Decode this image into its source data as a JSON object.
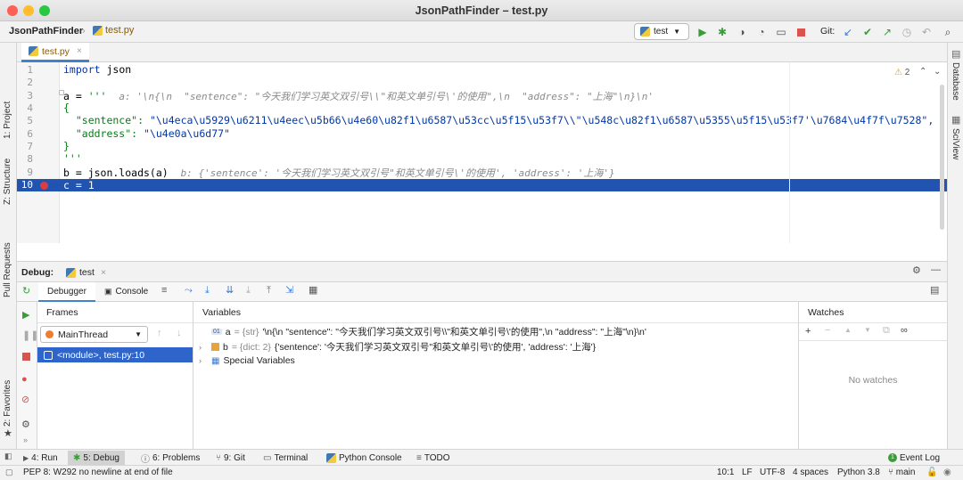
{
  "window": {
    "title": "JsonPathFinder – test.py"
  },
  "nav": {
    "project": "JsonPathFinder",
    "file": "test.py",
    "run_config": "test",
    "git_label": "Git:"
  },
  "left_stripe": {
    "project": "1: Project",
    "structure": "Z: Structure",
    "pull_requests": "Pull Requests",
    "favorites": "2: Favorites"
  },
  "right_stripe": {
    "database": "Database",
    "sciview": "SciView"
  },
  "editor": {
    "tab": "test.py",
    "warnings_count": "2",
    "line_numbers": [
      "1",
      "2",
      "3",
      "4",
      "5",
      "6",
      "7",
      "8",
      "9",
      "10"
    ],
    "line1": {
      "kw": "import",
      "rest": " json"
    },
    "line3": {
      "code": "a = ",
      "str": "'''",
      "inlay": "a: '\\n{\\n  \"sentence\": \"今天我们学习英文双引号\\\\\"和英文单引号\\'的使用\",\\n  \"address\": \"上海\"\\n}\\n'"
    },
    "line4": "{",
    "line5": {
      "key": "  \"sentence\"",
      "colon": ": ",
      "val": "\"\\u4eca\\u5929\\u6211\\u4eec\\u5b66\\u4e60\\u82f1\\u6587\\u53cc\\u5f15\\u53f7\\\\\"\\u548c\\u82f1\\u6587\\u5355\\u5f15\\u53f7'\\u7684\\u4f7f\\u7528\","
    },
    "line6": {
      "key": "  \"address\"",
      "colon": ": ",
      "val": "\"\\u4e0a\\u6d77\""
    },
    "line7": "}",
    "line8": "'''",
    "line9": {
      "code": "b = json.loads(a)",
      "inlay": "b: {'sentence': '今天我们学习英文双引号\"和英文单引号\\'的使用', 'address': '上海'}"
    },
    "line10": "c = 1"
  },
  "debug": {
    "label": "Debug:",
    "run_tab": "test",
    "tabs": {
      "debugger": "Debugger",
      "console": "Console"
    },
    "frames": {
      "title": "Frames",
      "thread": "MainThread",
      "frame": "<module>, test.py:10"
    },
    "variables": {
      "title": "Variables",
      "rows": [
        {
          "name": "a",
          "type": "= {str}",
          "value": "'\\n{\\n  \"sentence\": \"今天我们学习英文双引号\\\\\"和英文单引号\\'的使用\",\\n  \"address\": \"上海\"\\n}\\n'"
        },
        {
          "name": "b",
          "type": "= {dict: 2}",
          "value": "{'sentence': '今天我们学习英文双引号\"和英文单引号\\'的使用', 'address': '上海'}"
        },
        {
          "name": "Special Variables",
          "type": "",
          "value": ""
        }
      ]
    },
    "watches": {
      "title": "Watches",
      "empty": "No watches"
    }
  },
  "bottom_tools": {
    "run": "4: Run",
    "debug": "5: Debug",
    "problems": "6: Problems",
    "git": "9: Git",
    "terminal": "Terminal",
    "python_console": "Python Console",
    "todo": "TODO",
    "event_log": "Event Log"
  },
  "status": {
    "message": "PEP 8: W292 no newline at end of file",
    "position": "10:1",
    "line_sep": "LF",
    "encoding": "UTF-8",
    "indent": "4 spaces",
    "interpreter": "Python 3.8",
    "branch": "main"
  },
  "colors": {
    "selection": "#2154b0",
    "accent": "#4083c9",
    "breakpoint": "#dc3d3d"
  }
}
